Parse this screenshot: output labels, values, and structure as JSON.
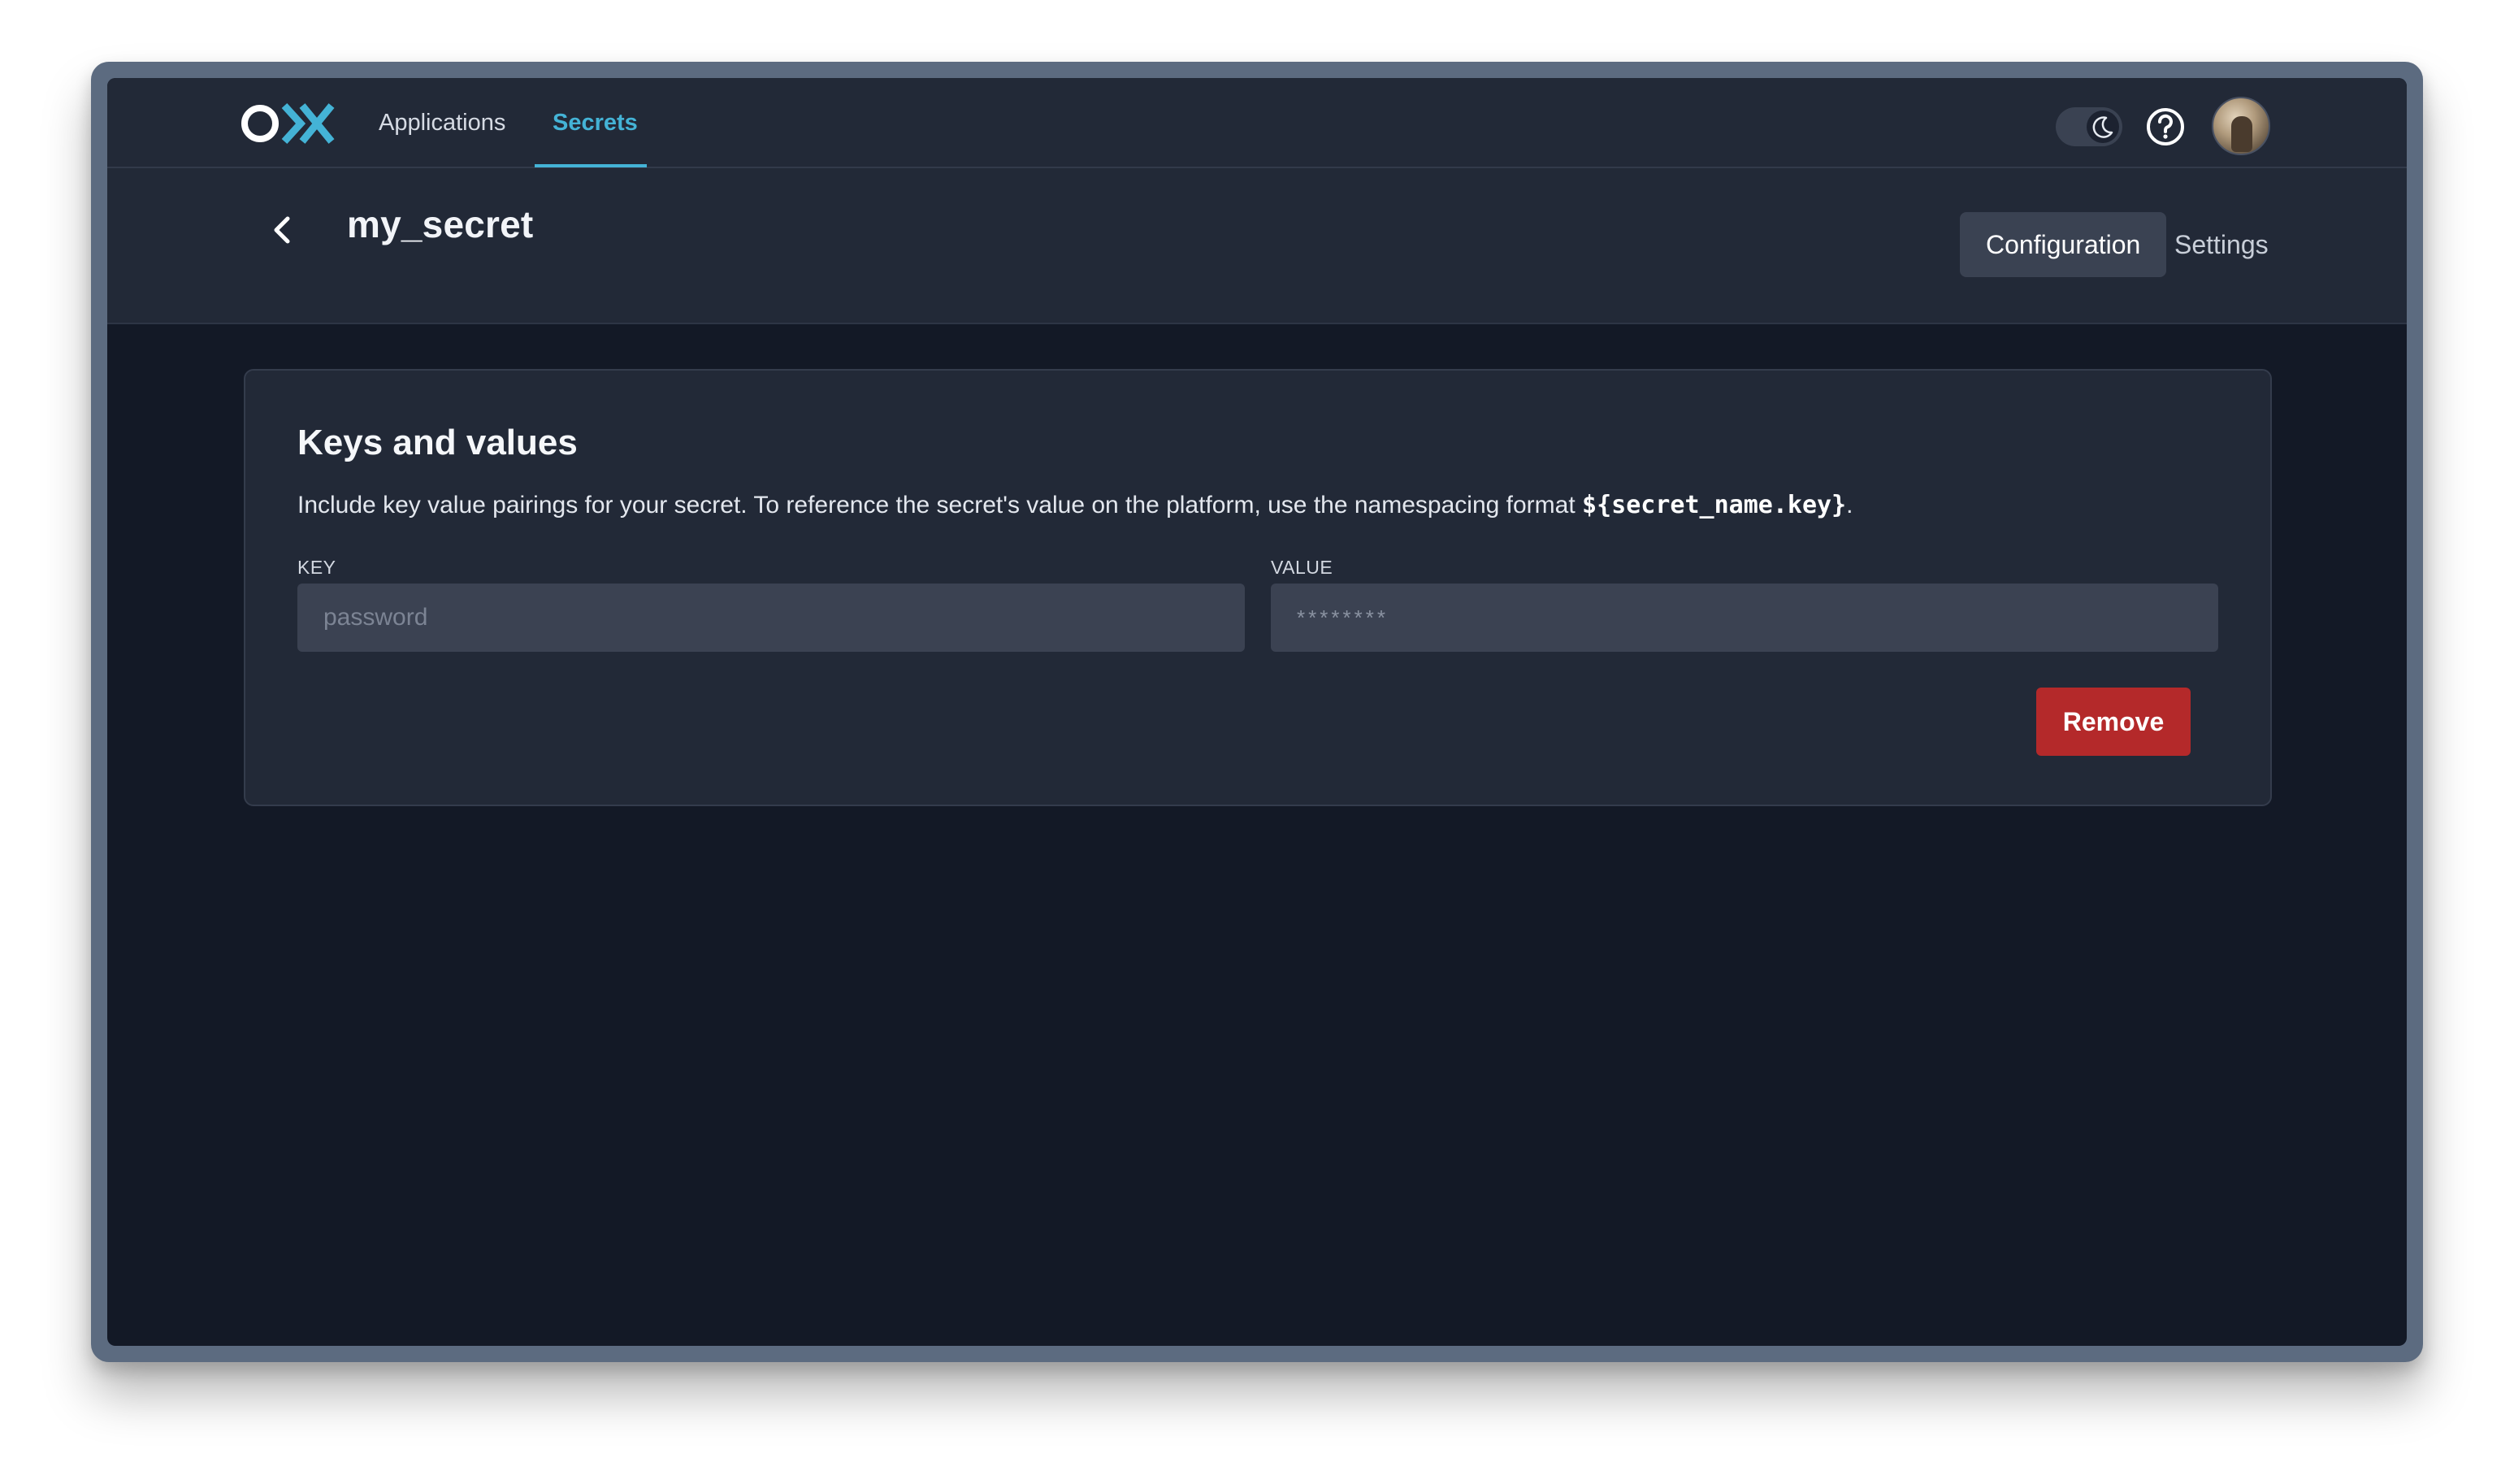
{
  "nav": {
    "logo_name": "ox-logo",
    "links": [
      {
        "label": "Applications",
        "active": false
      },
      {
        "label": "Secrets",
        "active": true
      }
    ],
    "theme_toggle_icon": "moon-icon",
    "help_icon": "question-circle-icon",
    "avatar_icon": "user-avatar"
  },
  "header": {
    "back_icon": "chevron-left-icon",
    "title": "my_secret",
    "tabs": [
      {
        "label": "Configuration",
        "active": true
      },
      {
        "label": "Settings",
        "active": false
      }
    ]
  },
  "card": {
    "title": "Keys and values",
    "description_prefix": "Include key value pairings for your secret. To reference the secret's value on the platform, use the namespacing format ",
    "description_code": "${secret_name.key}",
    "description_suffix": ".",
    "key_label": "KEY",
    "key_placeholder": "password",
    "value_label": "VALUE",
    "value_placeholder": "********",
    "remove_label": "Remove"
  },
  "colors": {
    "accent": "#44b3d6",
    "danger": "#b4292a",
    "background": "#131926",
    "surface": "#222937"
  }
}
